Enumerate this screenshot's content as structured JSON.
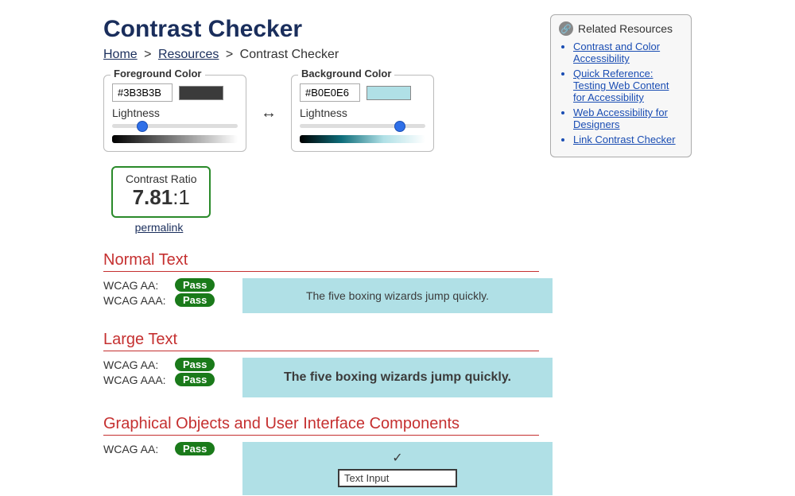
{
  "page": {
    "title": "Contrast Checker"
  },
  "breadcrumb": {
    "home": "Home",
    "resources": "Resources",
    "current": "Contrast Checker",
    "sep": ">"
  },
  "foreground": {
    "legend": "Foreground Color",
    "hex": "#3B3B3B",
    "lightness_label": "Lightness",
    "slider_pct": 24,
    "swatch_color": "#3B3B3B",
    "gradient": "linear-gradient(to right, #000000, #808080, #ffffff)"
  },
  "background": {
    "legend": "Background Color",
    "hex": "#B0E0E6",
    "lightness_label": "Lightness",
    "slider_pct": 80,
    "swatch_color": "#B0E0E6",
    "gradient": "linear-gradient(to right, #000000, #0e6d7a, #b0e0e6, #ffffff)"
  },
  "swap_label": "↔",
  "ratio": {
    "label": "Contrast Ratio",
    "bold": "7.81",
    "suffix": ":1",
    "permalink": "permalink"
  },
  "sections": {
    "normal": {
      "title": "Normal Text",
      "aa_label": "WCAG AA:",
      "aaa_label": "WCAG AAA:",
      "aa_result": "Pass",
      "aaa_result": "Pass",
      "sample": "The five boxing wizards jump quickly."
    },
    "large": {
      "title": "Large Text",
      "aa_label": "WCAG AA:",
      "aaa_label": "WCAG AAA:",
      "aa_result": "Pass",
      "aaa_result": "Pass",
      "sample": "The five boxing wizards jump quickly."
    },
    "ui": {
      "title": "Graphical Objects and User Interface Components",
      "aa_label": "WCAG AA:",
      "aa_result": "Pass",
      "check": "✓",
      "input_value": "Text Input"
    }
  },
  "sidebar": {
    "title": "Related Resources",
    "items": [
      "Contrast and Color Accessibility",
      "Quick Reference: Testing Web Content for Accessibility",
      "Web Accessibility for Designers",
      "Link Contrast Checker"
    ]
  }
}
